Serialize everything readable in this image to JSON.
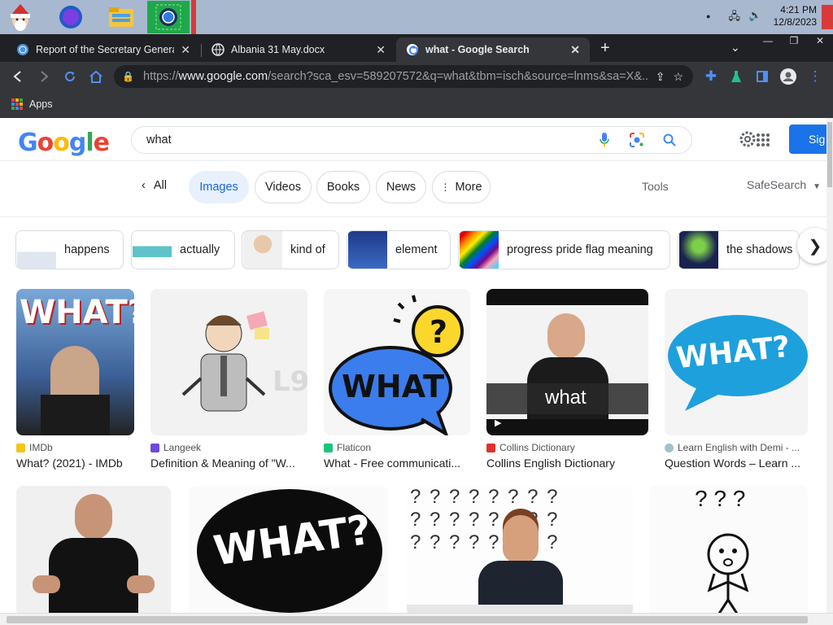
{
  "taskbar": {
    "clock_time": "4:21 PM",
    "clock_date": "12/8/2023",
    "icons": [
      "santa-icon",
      "browser-orb-icon",
      "file-explorer-icon",
      "chrome-app-icon"
    ]
  },
  "tabs": [
    {
      "title": "Report of the Secretary General o",
      "favicon": "un-icon",
      "active": false
    },
    {
      "title": "Albania 31 May.docx",
      "favicon": "globe-icon",
      "active": false
    },
    {
      "title": "what - Google Search",
      "favicon": "google-icon",
      "active": true
    }
  ],
  "toolbar": {
    "url_scheme": "https://",
    "url_host": "www.google.com",
    "url_rest": "/search?sca_esv=589207572&q=what&tbm=isch&source=lnms&sa=X&..."
  },
  "bookmarks": {
    "apps_label": "Apps"
  },
  "google": {
    "logo": "Google",
    "query": "what",
    "signin": "Sig"
  },
  "filters": {
    "all": "All",
    "chips": [
      "Images",
      "Videos",
      "Books",
      "News",
      "More"
    ],
    "tools": "Tools",
    "safesearch": "SafeSearch"
  },
  "related": [
    "happens",
    "actually",
    "kind of",
    "element",
    "progress pride flag meaning",
    "the shadows"
  ],
  "results_row1": [
    {
      "source": "IMDb",
      "title": "What? (2021) - IMDb",
      "image_text": "WHAT?"
    },
    {
      "source": "Langeek",
      "title": "Definition & Meaning of \"W...",
      "image_text": ""
    },
    {
      "source": "Flaticon",
      "title": "What - Free communicati...",
      "image_text": "WHAT"
    },
    {
      "source": "Collins Dictionary",
      "title": "Collins English Dictionary",
      "image_text": "what"
    },
    {
      "source": "Learn English with Demi - ...",
      "title": "Question Words – Learn ...",
      "image_text": "WHAT?"
    }
  ],
  "results_row2": [
    {
      "image_text": ""
    },
    {
      "image_text": "WHAT?"
    },
    {
      "image_text": "? ? ? ? ? ? ? ?"
    },
    {
      "image_text": "? ? ?"
    }
  ],
  "colors": {
    "accent": "#1a73e8",
    "chip_selected_bg": "#e8f0fe",
    "chrome_dark": "#202124"
  }
}
